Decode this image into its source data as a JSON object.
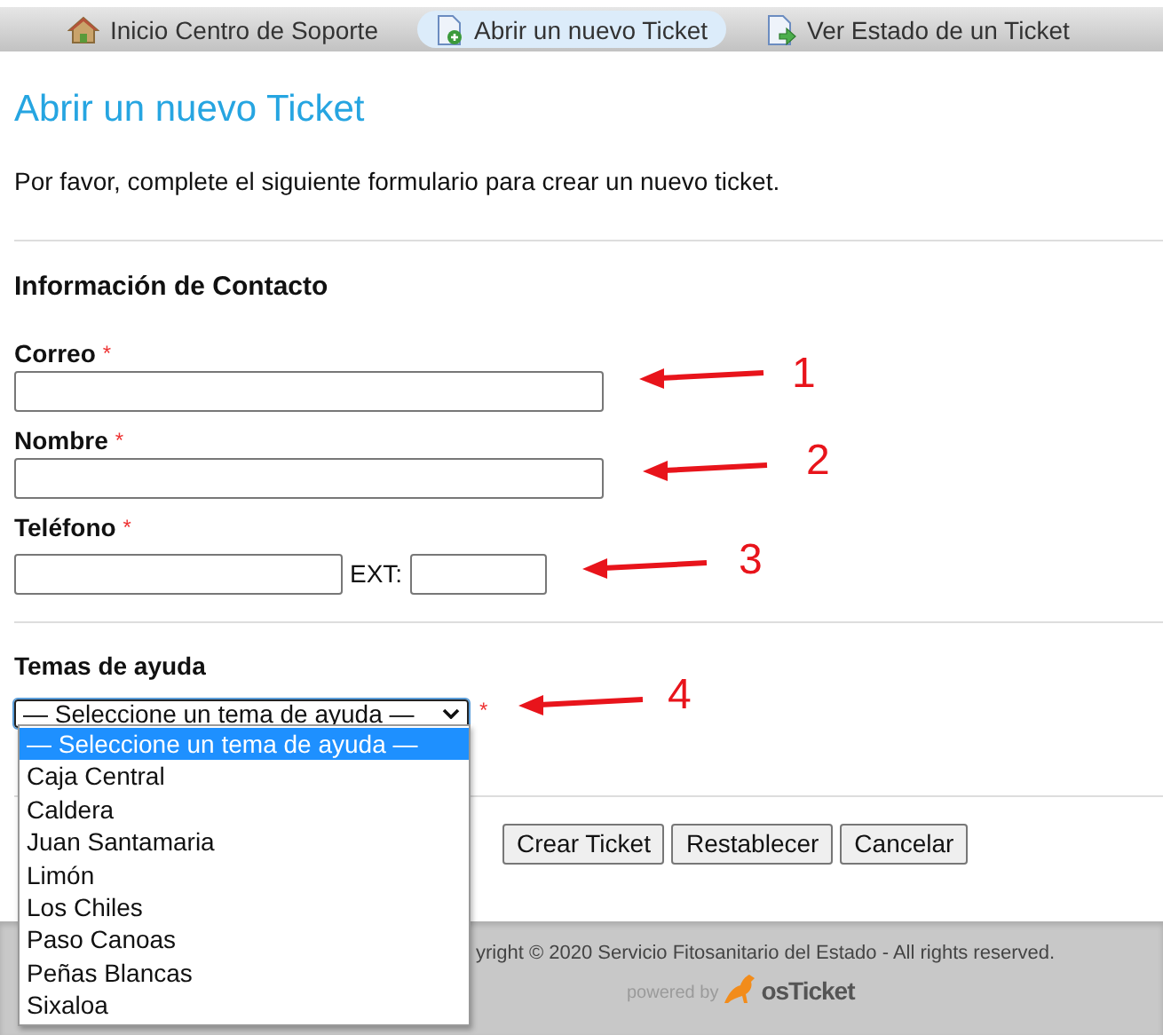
{
  "nav": {
    "tabs": [
      {
        "label": "Inicio Centro de Soporte",
        "selected": false
      },
      {
        "label": "Abrir un nuevo Ticket",
        "selected": true
      },
      {
        "label": "Ver Estado de un Ticket",
        "selected": false
      }
    ]
  },
  "page": {
    "title": "Abrir un nuevo Ticket",
    "intro": "Por favor, complete el siguiente formulario para crear un nuevo ticket."
  },
  "required_mark": "*",
  "contact": {
    "heading": "Información de Contacto",
    "fields": [
      {
        "label": "Correo",
        "required": true,
        "kind": "text"
      },
      {
        "label": "Nombre",
        "required": true,
        "kind": "text"
      },
      {
        "label": "Teléfono",
        "required": true,
        "kind": "phone",
        "ext_label": "EXT:"
      }
    ]
  },
  "help_topic": {
    "heading": "Temas de ayuda",
    "required": true,
    "select": {
      "value": "— Seleccione un tema de ayuda —",
      "expanded": true,
      "options": [
        {
          "label": "— Seleccione un tema de ayuda —",
          "selected": true
        },
        {
          "label": "Caja Central",
          "selected": false
        },
        {
          "label": "Caldera",
          "selected": false
        },
        {
          "label": "Juan Santamaria",
          "selected": false
        },
        {
          "label": "Limón",
          "selected": false
        },
        {
          "label": "Los Chiles",
          "selected": false
        },
        {
          "label": "Paso Canoas",
          "selected": false
        },
        {
          "label": "Peñas Blancas",
          "selected": false
        },
        {
          "label": "Sixaloa",
          "selected": false
        }
      ]
    }
  },
  "buttons": [
    "Crear Ticket",
    "Restablecer",
    "Cancelar"
  ],
  "footer": {
    "copyright": "yright © 2020 Servicio Fitosanitario del Estado - All rights reserved.",
    "powered_by": "powered by",
    "logo": "osTicket"
  },
  "annotations": [
    {
      "label": "1",
      "color": "#e8141b"
    },
    {
      "label": "2",
      "color": "#e8141b"
    },
    {
      "label": "3",
      "color": "#e8141b"
    },
    {
      "label": "4",
      "color": "#e8141b"
    }
  ]
}
